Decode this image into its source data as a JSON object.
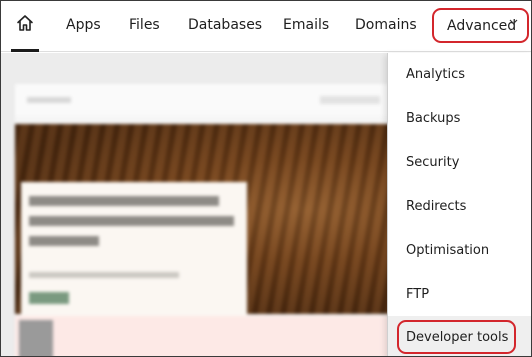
{
  "nav": {
    "home_icon": "home-icon",
    "items": [
      {
        "label": "Apps"
      },
      {
        "label": "Files"
      },
      {
        "label": "Databases"
      },
      {
        "label": "Emails"
      },
      {
        "label": "Domains"
      }
    ],
    "advanced_label": "Advanced",
    "advanced_icon": "chevron-down-icon"
  },
  "dropdown": {
    "items": [
      {
        "label": "Analytics"
      },
      {
        "label": "Backups"
      },
      {
        "label": "Security"
      },
      {
        "label": "Redirects"
      },
      {
        "label": "Optimisation"
      },
      {
        "label": "FTP"
      },
      {
        "label": "Developer tools"
      }
    ]
  },
  "colors": {
    "highlight": "#d3262c",
    "text": "#1e1e1e",
    "active_underline": "#1c1c1c"
  }
}
